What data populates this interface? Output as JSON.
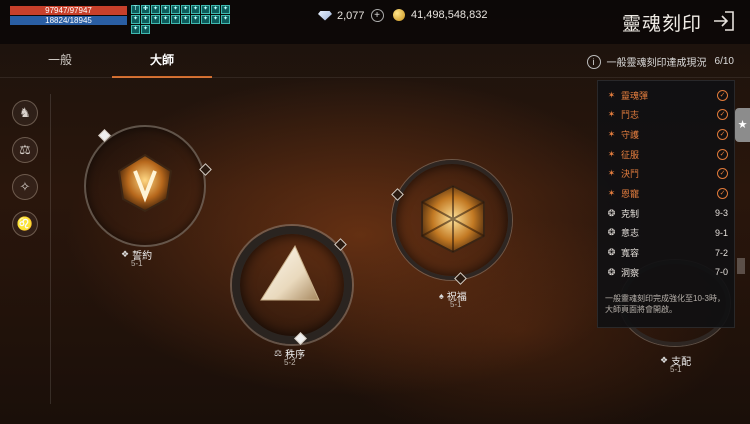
{
  "status": {
    "hp": "97947/97947",
    "mp": "18824/18945",
    "buffs": [
      "T",
      "✚",
      "✦",
      "✦",
      "✦",
      "✦",
      "✦",
      "✦",
      "✦",
      "✦",
      "✦",
      "✦",
      "✦",
      "✦",
      "✦",
      "✦",
      "✦",
      "✦",
      "✦",
      "✦",
      "✦",
      "✦"
    ]
  },
  "currency": {
    "diamond": "2,077",
    "plus": "+",
    "gold": "41,498,548,832"
  },
  "header": {
    "title": "靈魂刻印",
    "exit_icon": "exit-icon"
  },
  "tabs": [
    {
      "label": "一般",
      "active": false
    },
    {
      "label": "大師",
      "active": true
    }
  ],
  "achievement": {
    "info": "i",
    "label": "一般靈魂刻印達成現況",
    "count": "6/10"
  },
  "side_icons": [
    "♞",
    "⚖",
    "✧",
    "♌"
  ],
  "nodes": [
    {
      "name": "誓約",
      "level": "5-1",
      "icon": "❖"
    },
    {
      "name": "秩序",
      "level": "5-2",
      "icon": "⚖"
    },
    {
      "name": "祝福",
      "level": "5-1",
      "icon": "♠"
    },
    {
      "name": "支配",
      "level": "5-1",
      "icon": "❖"
    }
  ],
  "panel": {
    "rows": [
      {
        "label": "靈魂彈",
        "icon": "✶",
        "done": true,
        "value": ""
      },
      {
        "label": "鬥志",
        "icon": "✶",
        "done": true,
        "value": ""
      },
      {
        "label": "守護",
        "icon": "✶",
        "done": true,
        "value": ""
      },
      {
        "label": "征服",
        "icon": "✶",
        "done": true,
        "value": ""
      },
      {
        "label": "決鬥",
        "icon": "✶",
        "done": true,
        "value": ""
      },
      {
        "label": "恩寵",
        "icon": "✶",
        "done": true,
        "value": ""
      },
      {
        "label": "克制",
        "icon": "❂",
        "done": false,
        "value": "9-3"
      },
      {
        "label": "意志",
        "icon": "❂",
        "done": false,
        "value": "9-1"
      },
      {
        "label": "寬容",
        "icon": "❂",
        "done": false,
        "value": "7-2"
      },
      {
        "label": "洞察",
        "icon": "❂",
        "done": false,
        "value": "7-0"
      }
    ],
    "note": "一般靈魂刻印完成強化至10-3時，大師頁面將會開啟。",
    "check": "✓"
  },
  "star_tab": "★",
  "colors": {
    "accent": "#e07a3a",
    "hp": "#c8402b",
    "mp": "#2a5ea3"
  }
}
